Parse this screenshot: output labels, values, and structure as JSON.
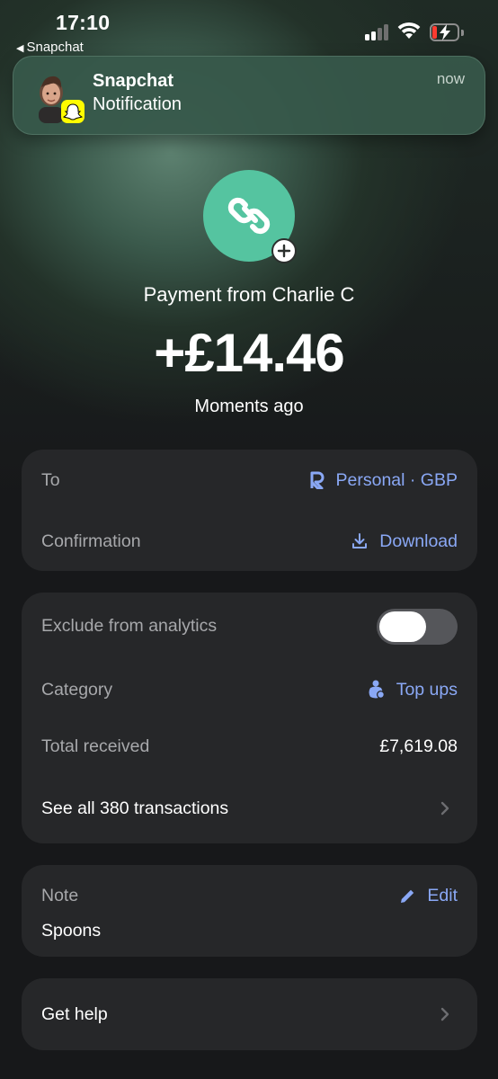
{
  "status_bar": {
    "time": "17:10",
    "back_app": "Snapchat",
    "battery_level": 0.1
  },
  "notification": {
    "app": "Snapchat",
    "body": "Notification",
    "time": "now"
  },
  "transaction": {
    "payer": "Payment from Charlie  C",
    "amount": "+£14.46",
    "time": "Moments ago"
  },
  "details": {
    "to_label": "To",
    "to_value": "Personal · GBP",
    "confirmation_label": "Confirmation",
    "confirmation_value": "Download"
  },
  "analytics": {
    "exclude_label": "Exclude from analytics",
    "exclude_on": false,
    "category_label": "Category",
    "category_value": "Top ups",
    "total_label": "Total received",
    "total_value": "£7,619.08",
    "see_all": "See all 380 transactions"
  },
  "note": {
    "label": "Note",
    "edit": "Edit",
    "text": "Spoons"
  },
  "help": {
    "label": "Get help"
  },
  "colors": {
    "accent": "#8aa8f5",
    "logo_bg": "#55c4a0",
    "card_bg": "#262729",
    "page_bg": "#17181a"
  }
}
